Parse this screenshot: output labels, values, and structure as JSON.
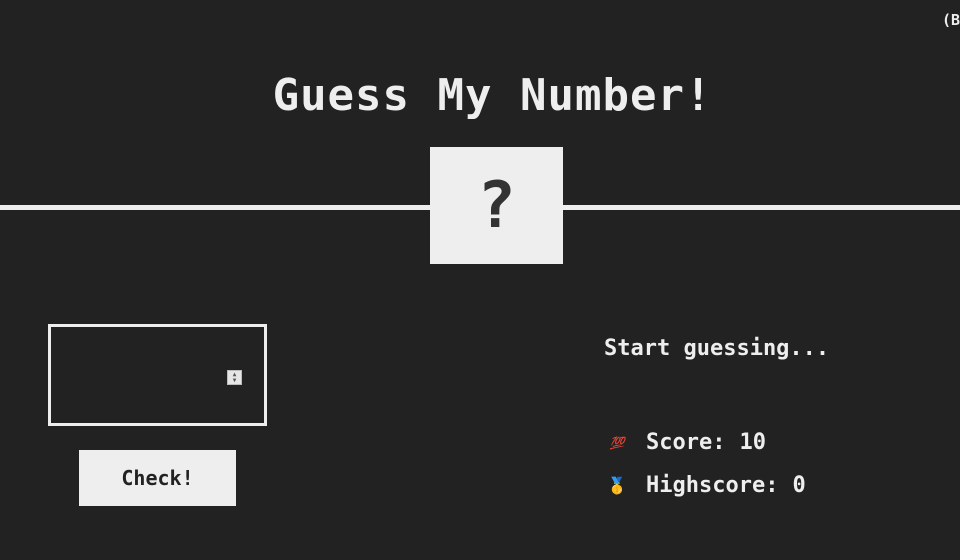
{
  "header": {
    "top_hint": "(B",
    "title": "Guess My Number!"
  },
  "number_box": {
    "value": "?"
  },
  "guess_input": {
    "value": ""
  },
  "check_button": {
    "label": "Check!"
  },
  "message": "Start guessing...",
  "stats": {
    "score_icon": "hundred-points-emoji",
    "score_label": "Score:",
    "score_value": "10",
    "highscore_icon": "medal-emoji",
    "highscore_label": "Highscore:",
    "highscore_value": "0"
  },
  "colors": {
    "background": "#222222",
    "foreground": "#eeeeee"
  }
}
